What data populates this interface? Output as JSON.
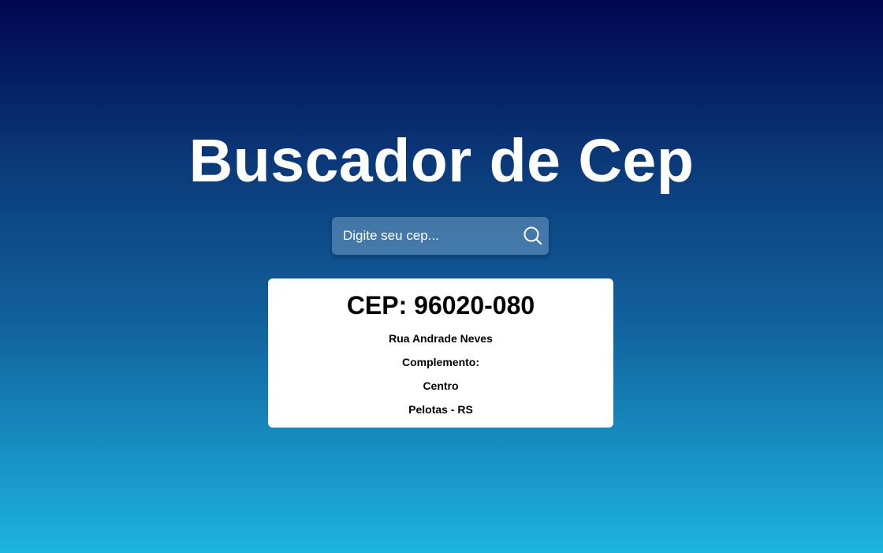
{
  "page": {
    "title": "Buscador de Cep"
  },
  "search": {
    "placeholder": "Digite seu cep...",
    "value": "",
    "icon": "search-icon"
  },
  "result": {
    "cep_label": "CEP: 96020-080",
    "street": "Rua Andrade Neves",
    "complement": "Complemento:",
    "district": "Centro",
    "city_state": "Pelotas - RS"
  },
  "colors": {
    "gradient_top": "#000650",
    "gradient_bottom": "#1cb4e0",
    "card_background": "#ffffff",
    "title_color": "#ffffff"
  }
}
